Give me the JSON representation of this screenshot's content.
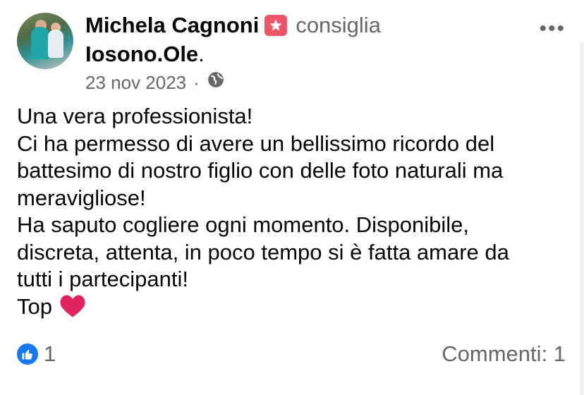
{
  "post": {
    "author": "Michela Cagnoni",
    "verb": "consiglia",
    "page": "Iosono.Ole",
    "period": ".",
    "date": "23 nov 2023",
    "separator": "·",
    "audience_icon": "globe-icon",
    "more_icon": "more-options-icon",
    "more_text": "•••",
    "recommend_icon": "recommend-star-icon"
  },
  "content": {
    "lines": [
      "Una vera professionista!",
      "Ci ha permesso di avere un bellissimo ricordo del",
      "battesimo di nostro figlio con delle foto naturali ma",
      "meravigliose!",
      "Ha saputo cogliere ogni momento. Disponibile,",
      "discreta, attenta, in poco tempo si è fatta amare da",
      "tutti i partecipanti!",
      "Top"
    ],
    "emoji": "heart-emoji"
  },
  "footer": {
    "like_count": "1",
    "comments": "Commenti: 1",
    "like_icon": "like-thumb-icon"
  },
  "colors": {
    "accent": "#1877f2",
    "recommend": "#f0566a",
    "secondary_text": "#65676b",
    "heart": "#e0245e"
  }
}
